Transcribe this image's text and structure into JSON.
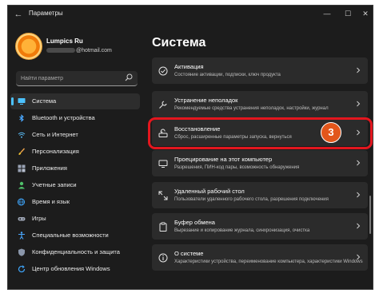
{
  "window": {
    "title": "Параметры"
  },
  "user": {
    "name": "Lumpics Ru",
    "email_suffix": "@hotmail.com"
  },
  "search": {
    "placeholder": "Найти параметр"
  },
  "sidebar": {
    "items": [
      {
        "label": "Система",
        "icon": "monitor-icon",
        "active": true
      },
      {
        "label": "Bluetooth и устройства",
        "icon": "bluetooth-icon"
      },
      {
        "label": "Сеть и Интернет",
        "icon": "wifi-icon"
      },
      {
        "label": "Персонализация",
        "icon": "brush-icon"
      },
      {
        "label": "Приложения",
        "icon": "apps-icon"
      },
      {
        "label": "Учетные записи",
        "icon": "person-icon"
      },
      {
        "label": "Время и язык",
        "icon": "globe-clock-icon"
      },
      {
        "label": "Игры",
        "icon": "gamepad-icon"
      },
      {
        "label": "Специальные возможности",
        "icon": "accessibility-icon"
      },
      {
        "label": "Конфиденциальность и защита",
        "icon": "shield-icon"
      },
      {
        "label": "Центр обновления Windows",
        "icon": "update-icon"
      }
    ]
  },
  "main": {
    "title": "Система",
    "cards": [
      {
        "title": "Активация",
        "subtitle": "Состояние активации, подписки, ключ продукта",
        "icon": "activation-icon"
      },
      {
        "title": "Устранение неполадок",
        "subtitle": "Рекомендуемые средства устранения неполадок, настройки, журнал",
        "icon": "wrench-icon"
      },
      {
        "title": "Восстановление",
        "subtitle": "Сброс, расширенные параметры запуска, вернуться",
        "icon": "recovery-icon"
      },
      {
        "title": "Проецирование на этот компьютер",
        "subtitle": "Разрешения, ПИН-код пары, возможность обнаружения",
        "icon": "projection-icon"
      },
      {
        "title": "Удаленный рабочий стол",
        "subtitle": "Пользователи удаленного рабочего стола, разрешения подключения",
        "icon": "remote-desktop-icon"
      },
      {
        "title": "Буфер обмена",
        "subtitle": "Вырезание и копирование журнала, синхронизация, очистка",
        "icon": "clipboard-icon"
      },
      {
        "title": "О системе",
        "subtitle": "Характеристики устройства, переименование компьютера, характеристики Windows",
        "icon": "info-icon"
      }
    ],
    "step_badge": "3"
  },
  "colors": {
    "accent": "#4cc2ff",
    "highlight": "#e3161e",
    "badge": "#e2561b"
  }
}
